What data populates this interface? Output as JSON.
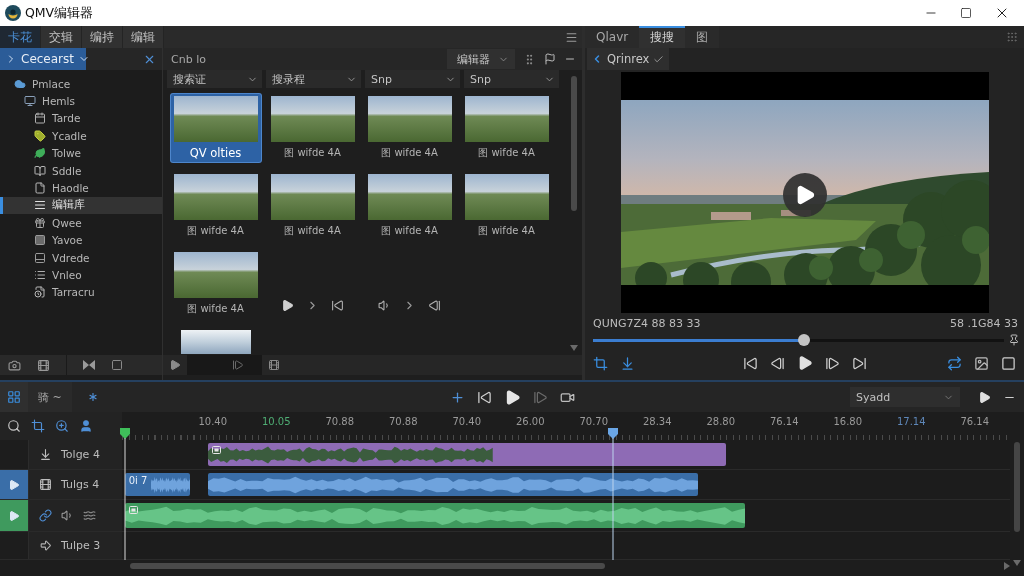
{
  "window": {
    "title": "QMV编辑器"
  },
  "library": {
    "tabs": [
      {
        "label": "卡花",
        "selected": true
      },
      {
        "label": "交辑",
        "selected": false
      },
      {
        "label": "编持",
        "selected": false
      },
      {
        "label": "编辑",
        "selected": false
      }
    ],
    "sidebar": {
      "header": "Cecearst",
      "tree": [
        {
          "label": "Pmlace",
          "selected": false,
          "children": [
            {
              "label": "Hemls",
              "selected": false,
              "children": [
                {
                  "label": "Tarde",
                  "selected": false
                },
                {
                  "label": "Ycadle",
                  "selected": false
                },
                {
                  "label": "Tolwe",
                  "selected": false
                },
                {
                  "label": "Sddle",
                  "selected": false
                },
                {
                  "label": "Haodle",
                  "selected": false
                },
                {
                  "label": "编辑库",
                  "selected": true
                },
                {
                  "label": "Qwee",
                  "selected": false
                },
                {
                  "label": "Yavoe",
                  "selected": false
                },
                {
                  "label": "Vdrede",
                  "selected": false
                },
                {
                  "label": "Vnleo",
                  "selected": false
                },
                {
                  "label": "Tarracru",
                  "selected": false
                }
              ]
            }
          ]
        }
      ]
    },
    "media": {
      "title": "Cnb lo",
      "view_select": "编辑器",
      "filters": [
        "搜索证",
        "搜录程",
        "Snp",
        "Snp"
      ],
      "items": [
        {
          "kind": "clip",
          "label": "QV olties",
          "selected": true
        },
        {
          "kind": "clip",
          "label": "图 wifde 4A",
          "selected": false
        },
        {
          "kind": "clip",
          "label": "图 wifde 4A",
          "selected": false
        },
        {
          "kind": "clip",
          "label": "图 wifde 4A",
          "selected": false
        },
        {
          "kind": "clip",
          "label": "图 wifde 4A",
          "selected": false
        },
        {
          "kind": "clip",
          "label": "图 wifde 4A",
          "selected": false
        },
        {
          "kind": "clip",
          "label": "图 wifde 4A",
          "selected": false
        },
        {
          "kind": "clip",
          "label": "图 wifde 4A",
          "selected": false
        },
        {
          "kind": "clip",
          "label": "图 wifde 4A",
          "selected": false
        },
        {
          "kind": "controls"
        },
        {
          "kind": "controls"
        },
        {
          "kind": "partial",
          "selected": false
        }
      ]
    }
  },
  "preview": {
    "tabs": [
      {
        "label": "Qlavr",
        "selected": false
      },
      {
        "label": "搜搜",
        "selected": true
      },
      {
        "label": "图",
        "selected": false
      }
    ],
    "subtab": "Qrinrex",
    "timecode_left": "QUNG7Z4 88 83 33",
    "timecode_right": "58 .1G84 33",
    "scrubber": {
      "level": 0.514
    }
  },
  "timeline": {
    "mode_label": "骑 ~",
    "zoom_select": "Syadd",
    "ruler": [
      {
        "label": "10.40",
        "color": "#9a9a9a"
      },
      {
        "label": "10.05",
        "color": "#4fae74"
      },
      {
        "label": "70.88",
        "color": "#9a9a9a"
      },
      {
        "label": "70.88",
        "color": "#9a9a9a"
      },
      {
        "label": "70.40",
        "color": "#9a9a9a"
      },
      {
        "label": "26.00",
        "color": "#9a9a9a"
      },
      {
        "label": "70.70",
        "color": "#9a9a9a"
      },
      {
        "label": "28.34",
        "color": "#9a9a9a"
      },
      {
        "label": "28.80",
        "color": "#9a9a9a"
      },
      {
        "label": "76.14",
        "color": "#9a9a9a"
      },
      {
        "label": "16.80",
        "color": "#9a9a9a"
      },
      {
        "label": "17.14",
        "color": "#5d86b8"
      },
      {
        "label": "76.14",
        "color": "#9a9a9a"
      }
    ],
    "playhead": {
      "level": 0.553
    },
    "tracks": [
      {
        "name": "Tolge 4",
        "armed": false,
        "color": "#8e6bb5"
      },
      {
        "name": "Tulgs 4",
        "armed": true,
        "color": "#3a6ea8",
        "clip_label": "0i 7"
      },
      {
        "armed": true,
        "color": "#3f9a5e"
      },
      {
        "name": "Tulpe 3",
        "armed": false
      }
    ]
  }
}
